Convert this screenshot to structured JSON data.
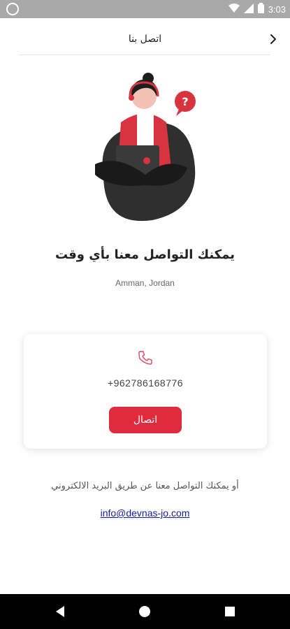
{
  "status_bar": {
    "time": "3:03"
  },
  "header": {
    "title": "اتصل بنا"
  },
  "content": {
    "title": "يمكنك التواصل معنا بأي وقت",
    "location": "Amman, Jordan"
  },
  "contact_card": {
    "phone": "+962786168776",
    "call_label": "اتصال"
  },
  "email_section": {
    "text": "أو يمكنك التواصل معنا عن طريق البريد الالكتروني",
    "email": "info@devnas-jo.com"
  },
  "colors": {
    "accent": "#e02b3c"
  }
}
